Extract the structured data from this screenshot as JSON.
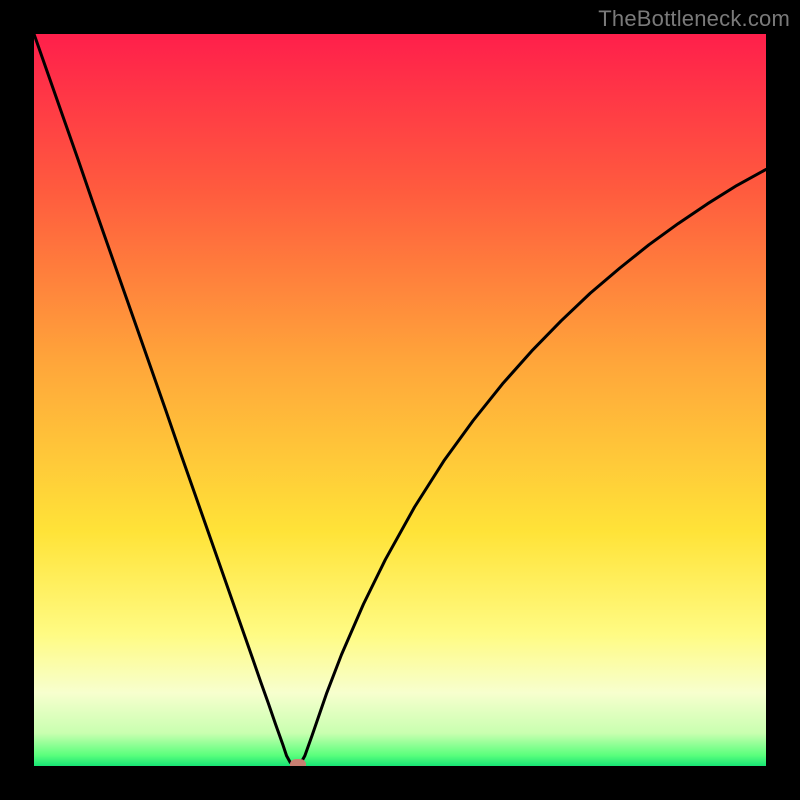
{
  "watermark": "TheBottleneck.com",
  "chart_data": {
    "type": "line",
    "title": "",
    "xlabel": "",
    "ylabel": "",
    "xlim": [
      0,
      100
    ],
    "ylim": [
      0,
      100
    ],
    "series": [
      {
        "name": "bottleneck-curve",
        "x": [
          0,
          2,
          4,
          6,
          8,
          10,
          12,
          14,
          16,
          18,
          20,
          22,
          24,
          26,
          28,
          30,
          31,
          32,
          33,
          34,
          34.5,
          35,
          35.5,
          36,
          36.5,
          37,
          38,
          40,
          42,
          45,
          48,
          52,
          56,
          60,
          64,
          68,
          72,
          76,
          80,
          84,
          88,
          92,
          96,
          100
        ],
        "y": [
          100,
          94.3,
          88.6,
          82.9,
          77.1,
          71.4,
          65.7,
          60,
          54.3,
          48.6,
          42.8,
          37.1,
          31.4,
          25.7,
          20,
          14.3,
          11.4,
          8.6,
          5.7,
          2.9,
          1.4,
          0.5,
          0.2,
          0.2,
          0.5,
          1.4,
          4.2,
          10,
          15.2,
          22.1,
          28.2,
          35.4,
          41.7,
          47.2,
          52.2,
          56.7,
          60.8,
          64.6,
          68,
          71.2,
          74.1,
          76.8,
          79.3,
          81.5
        ]
      }
    ],
    "minimum_marker": {
      "x": 36,
      "y": 0.2
    },
    "gradient_stops": [
      {
        "offset": 0.0,
        "color": "#ff1f4b"
      },
      {
        "offset": 0.22,
        "color": "#ff5d3e"
      },
      {
        "offset": 0.45,
        "color": "#ffa63a"
      },
      {
        "offset": 0.68,
        "color": "#ffe338"
      },
      {
        "offset": 0.82,
        "color": "#fffb83"
      },
      {
        "offset": 0.9,
        "color": "#f7ffce"
      },
      {
        "offset": 0.955,
        "color": "#c9ffb0"
      },
      {
        "offset": 0.985,
        "color": "#5cff7d"
      },
      {
        "offset": 1.0,
        "color": "#17e574"
      }
    ]
  }
}
